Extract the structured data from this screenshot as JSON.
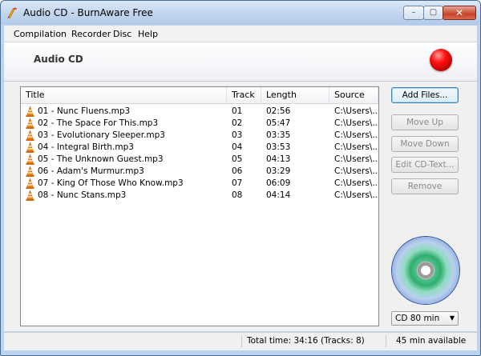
{
  "window": {
    "title": "Audio CD - BurnAware Free",
    "controls": {
      "minimize": "–",
      "maximize": "▢",
      "close": "✕"
    }
  },
  "menu": {
    "items": [
      "Compilation",
      "Recorder",
      "Disc",
      "Help"
    ]
  },
  "header": {
    "title": "Audio CD"
  },
  "filelist": {
    "columns": [
      "Title",
      "Track",
      "Length",
      "Source"
    ],
    "rows": [
      {
        "title": "01 - Nunc Fluens.mp3",
        "track": "01",
        "length": "02:56",
        "source": "C:\\Users\\..."
      },
      {
        "title": "02 - The Space For This.mp3",
        "track": "02",
        "length": "05:47",
        "source": "C:\\Users\\..."
      },
      {
        "title": "03 - Evolutionary Sleeper.mp3",
        "track": "03",
        "length": "03:35",
        "source": "C:\\Users\\..."
      },
      {
        "title": "04 - Integral Birth.mp3",
        "track": "04",
        "length": "03:53",
        "source": "C:\\Users\\..."
      },
      {
        "title": "05 - The Unknown Guest.mp3",
        "track": "05",
        "length": "04:13",
        "source": "C:\\Users\\..."
      },
      {
        "title": "06 - Adam's Murmur.mp3",
        "track": "06",
        "length": "03:29",
        "source": "C:\\Users\\..."
      },
      {
        "title": "07 - King Of Those Who Know.mp3",
        "track": "07",
        "length": "06:09",
        "source": "C:\\Users\\..."
      },
      {
        "title": "08 - Nunc Stans.mp3",
        "track": "08",
        "length": "04:14",
        "source": "C:\\Users\\..."
      }
    ]
  },
  "actions": {
    "add_files": "Add Files...",
    "move_up": "Move Up",
    "move_down": "Move Down",
    "edit_cd_text": "Edit CD-Text...",
    "remove": "Remove"
  },
  "disc_size": {
    "selected": "CD 80 min"
  },
  "status": {
    "total": "Total time: 34:16 (Tracks: 8)",
    "available": "45 min available"
  },
  "colors": {
    "burn_button": "#e81010",
    "titlebar": "#c1d5ee"
  }
}
